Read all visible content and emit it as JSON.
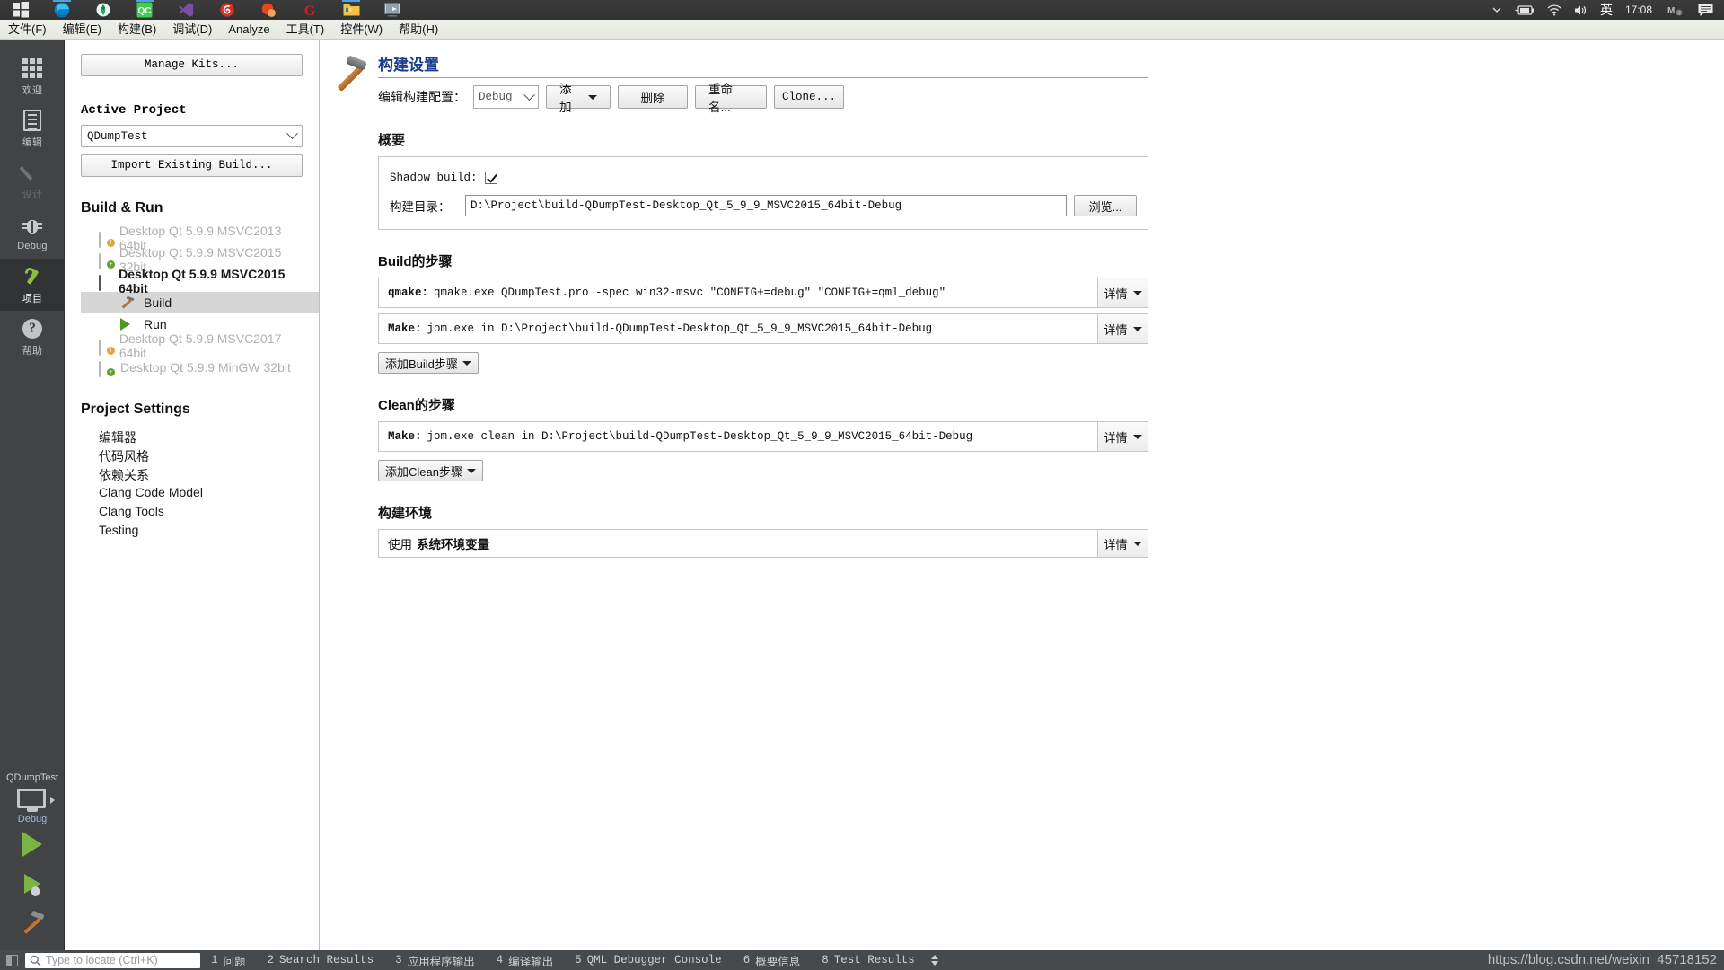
{
  "taskbar": {
    "icons": [
      {
        "name": "windows-start-icon",
        "glyph": "start"
      },
      {
        "name": "microsoft-edge-icon",
        "glyph": "edge"
      },
      {
        "name": "app-icon-green",
        "glyph": "green"
      },
      {
        "name": "qt-creator-icon",
        "glyph": "qc"
      },
      {
        "name": "visual-studio-icon",
        "glyph": "vs"
      },
      {
        "name": "app-icon-red-swirl",
        "glyph": "swirl"
      },
      {
        "name": "ccleaner-icon",
        "glyph": "ccleaner"
      },
      {
        "name": "app-icon-g-red",
        "glyph": "gred"
      },
      {
        "name": "file-explorer-icon",
        "glyph": "folder"
      },
      {
        "name": "remote-desktop-icon",
        "glyph": "remote"
      }
    ],
    "tray": {
      "chevron": "show-hidden-icons",
      "battery": "battery-icon",
      "network": "wifi-icon",
      "volume": "volume-icon",
      "language": "英",
      "clock": "17:08",
      "extra": "ime-status-icon",
      "notifications": "notification-icon"
    }
  },
  "menubar": {
    "items": [
      {
        "label": "文件(F)",
        "name": "menu-file"
      },
      {
        "label": "编辑(E)",
        "name": "menu-edit"
      },
      {
        "label": "构建(B)",
        "name": "menu-build"
      },
      {
        "label": "调试(D)",
        "name": "menu-debug"
      },
      {
        "label": "Analyze",
        "name": "menu-analyze"
      },
      {
        "label": "工具(T)",
        "name": "menu-tools"
      },
      {
        "label": "控件(W)",
        "name": "menu-window"
      },
      {
        "label": "帮助(H)",
        "name": "menu-help"
      }
    ]
  },
  "modebar": {
    "items": [
      {
        "label": "欢迎",
        "icon": "grid-icon",
        "state": "normal"
      },
      {
        "label": "编辑",
        "icon": "document-icon",
        "state": "normal"
      },
      {
        "label": "设计",
        "icon": "pencil-icon",
        "state": "disabled"
      },
      {
        "label": "Debug",
        "icon": "bug-icon",
        "state": "normal"
      },
      {
        "label": "项目",
        "icon": "wrench-icon",
        "state": "active"
      },
      {
        "label": "帮助",
        "icon": "question-icon",
        "state": "normal"
      }
    ],
    "kit_selector": {
      "project": "QDumpTest",
      "icon": "desktop-monitor-icon",
      "config": "Debug"
    },
    "run_button": "run-icon",
    "debug_button": "debug-run-icon",
    "build_button": "build-hammer-icon"
  },
  "sidepanel": {
    "manage_kits": "Manage Kits...",
    "active_project_heading": "Active Project",
    "active_project_value": "QDumpTest",
    "import_existing_build": "Import Existing Build...",
    "build_and_run_heading": "Build & Run",
    "kits": [
      {
        "label": "Desktop Qt 5.9.9 MSVC2013 64bit",
        "state": "disabled",
        "icon": "desktop-warning-icon"
      },
      {
        "label": "Desktop Qt 5.9.9 MSVC2015 32bit",
        "state": "disabled",
        "icon": "desktop-add-icon"
      },
      {
        "label": "Desktop Qt 5.9.9 MSVC2015 64bit",
        "state": "active",
        "icon": "desktop-icon",
        "children": [
          {
            "label": "Build",
            "icon": "hammer-icon",
            "selected": true
          },
          {
            "label": "Run",
            "icon": "run-triangle-icon",
            "selected": false
          }
        ]
      },
      {
        "label": "Desktop Qt 5.9.9 MSVC2017 64bit",
        "state": "disabled",
        "icon": "desktop-warning-icon"
      },
      {
        "label": "Desktop Qt 5.9.9 MinGW 32bit",
        "state": "disabled",
        "icon": "desktop-add-icon"
      }
    ],
    "project_settings_heading": "Project Settings",
    "project_settings": [
      {
        "label": "编辑器"
      },
      {
        "label": "代码风格"
      },
      {
        "label": "依赖关系"
      },
      {
        "label": "Clang Code Model"
      },
      {
        "label": "Clang Tools"
      },
      {
        "label": "Testing"
      }
    ]
  },
  "main": {
    "title": "构建设置",
    "config_label": "编辑构建配置：",
    "config_value": "Debug",
    "buttons": {
      "add": "添加",
      "remove": "删除",
      "rename": "重命名...",
      "clone": "Clone..."
    },
    "summary": {
      "heading": "概要",
      "shadow_build_label": "Shadow build:",
      "shadow_build_checked": true,
      "build_dir_label": "构建目录：",
      "build_dir_value": "D:\\Project\\build-QDumpTest-Desktop_Qt_5_9_9_MSVC2015_64bit-Debug",
      "browse": "浏览..."
    },
    "build_steps": {
      "heading": "Build的步骤",
      "detail_label": "详情",
      "add_label": "添加Build步骤",
      "steps": [
        {
          "name": "qmake:",
          "cmd": "qmake.exe QDumpTest.pro -spec win32-msvc \"CONFIG+=debug\" \"CONFIG+=qml_debug\""
        },
        {
          "name": "Make:",
          "cmd": "jom.exe in D:\\Project\\build-QDumpTest-Desktop_Qt_5_9_9_MSVC2015_64bit-Debug"
        }
      ]
    },
    "clean_steps": {
      "heading": "Clean的步骤",
      "detail_label": "详情",
      "add_label": "添加Clean步骤",
      "steps": [
        {
          "name": "Make:",
          "cmd": "jom.exe clean in D:\\Project\\build-QDumpTest-Desktop_Qt_5_9_9_MSVC2015_64bit-Debug"
        }
      ]
    },
    "build_env": {
      "heading": "构建环境",
      "use_label": "使用",
      "value": "系统环境变量",
      "detail_label": "详情"
    }
  },
  "statusbar": {
    "toggle": "toggle-sidebar-icon",
    "search_placeholder": "Type to locate (Ctrl+K)",
    "search_icon": "search-icon",
    "panes": [
      {
        "num": "1",
        "label": "问题",
        "mono": false
      },
      {
        "num": "2",
        "label": "Search Results",
        "mono": true
      },
      {
        "num": "3",
        "label": "应用程序输出",
        "mono": false
      },
      {
        "num": "4",
        "label": "编译输出",
        "mono": false
      },
      {
        "num": "5",
        "label": "QML Debugger Console",
        "mono": true
      },
      {
        "num": "6",
        "label": "概要信息",
        "mono": false
      },
      {
        "num": "8",
        "label": "Test Results",
        "mono": true
      }
    ],
    "updown": "pane-updown-icon"
  },
  "watermark": "https://blog.csdn.net/weixin_45718152",
  "colors": {
    "accent_title": "#1a3c8c",
    "modebar_bg": "#414345",
    "modebar_active": "#313335",
    "green": "#8fbd3f",
    "statusbar_bg": "#474a4c"
  }
}
